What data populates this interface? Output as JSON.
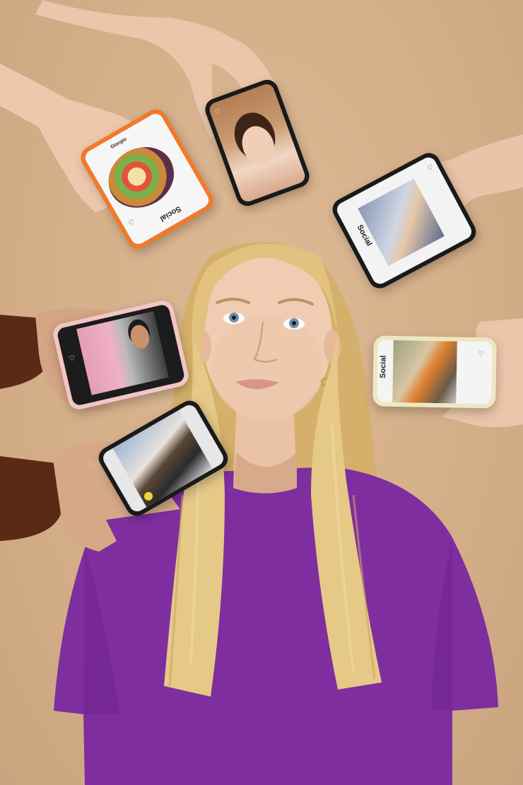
{
  "scene": {
    "background_color": "#d9b590",
    "shirt_color": "#7f2e9f",
    "hair_color": "#e0c07a"
  },
  "phones": [
    {
      "id": "phone-food",
      "case_color": "#f07a2a",
      "app_label": "Social",
      "user_label": "Giorgio"
    },
    {
      "id": "phone-selfie",
      "case_color": "#1a1a1a",
      "app_label": "",
      "user_label": ""
    },
    {
      "id": "phone-friends",
      "case_color": "#1a1a1a",
      "app_label": "Social",
      "user_label": ""
    },
    {
      "id": "phone-man-pink",
      "case_color": "#f2c6c6",
      "app_label": "",
      "user_label": ""
    },
    {
      "id": "phone-yellow",
      "case_color": "#efe7c2",
      "app_label": "Social",
      "user_label": ""
    },
    {
      "id": "phone-couple",
      "case_color": "#1a1a1a",
      "app_label": "",
      "user_label": ""
    }
  ]
}
